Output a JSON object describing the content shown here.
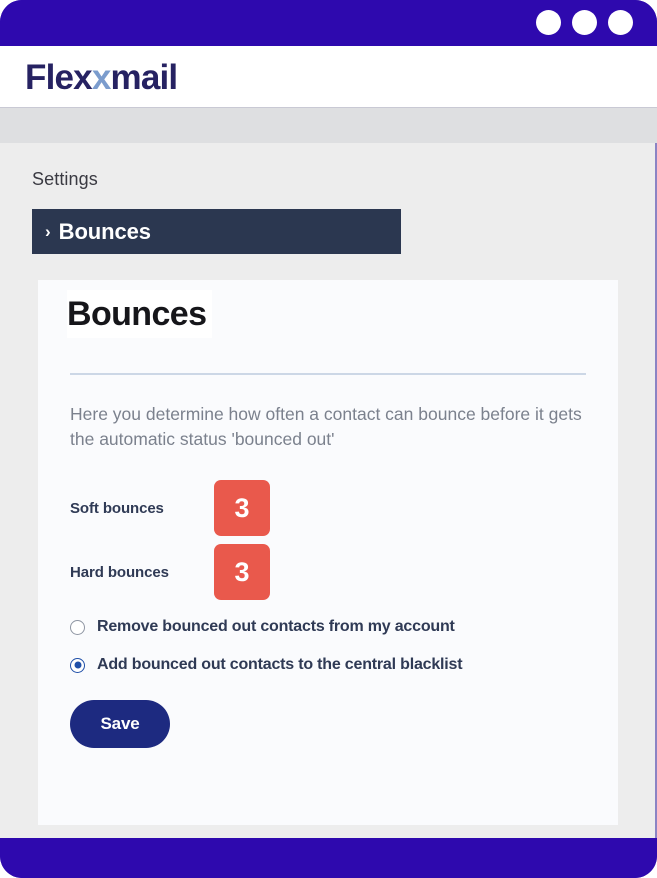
{
  "window": {
    "dots": [
      "window-dot-1",
      "window-dot-2",
      "window-dot-3"
    ],
    "chrome_color": "#2E09AE"
  },
  "app": {
    "logo_main": "Flex",
    "logo_accent": "x",
    "logo_tail": "mail",
    "logo_full": "Flexmail",
    "logo_color": "#262262",
    "logo_accent_color": "#7b9ccd"
  },
  "page": {
    "breadcrumb": "Settings",
    "section_tab": {
      "chevron": "›",
      "label": "Bounces",
      "background": "#2b3750"
    }
  },
  "card": {
    "title": "Bounces",
    "description": "Here you determine how often a contact can bounce before it gets the automatic status 'bounced out'",
    "fields": [
      {
        "label": "Soft bounces",
        "value": "3"
      },
      {
        "label": "Hard bounces",
        "value": "3"
      }
    ],
    "field_accent_color": "#e9594c",
    "radios": [
      {
        "label": "Remove bounced out contacts from my account",
        "checked": false
      },
      {
        "label": "Add bounced out contacts to the central blacklist",
        "checked": true
      }
    ],
    "radio_accent_color": "#1f4fa8",
    "save_label": "Save",
    "save_color": "#1d2a80"
  }
}
